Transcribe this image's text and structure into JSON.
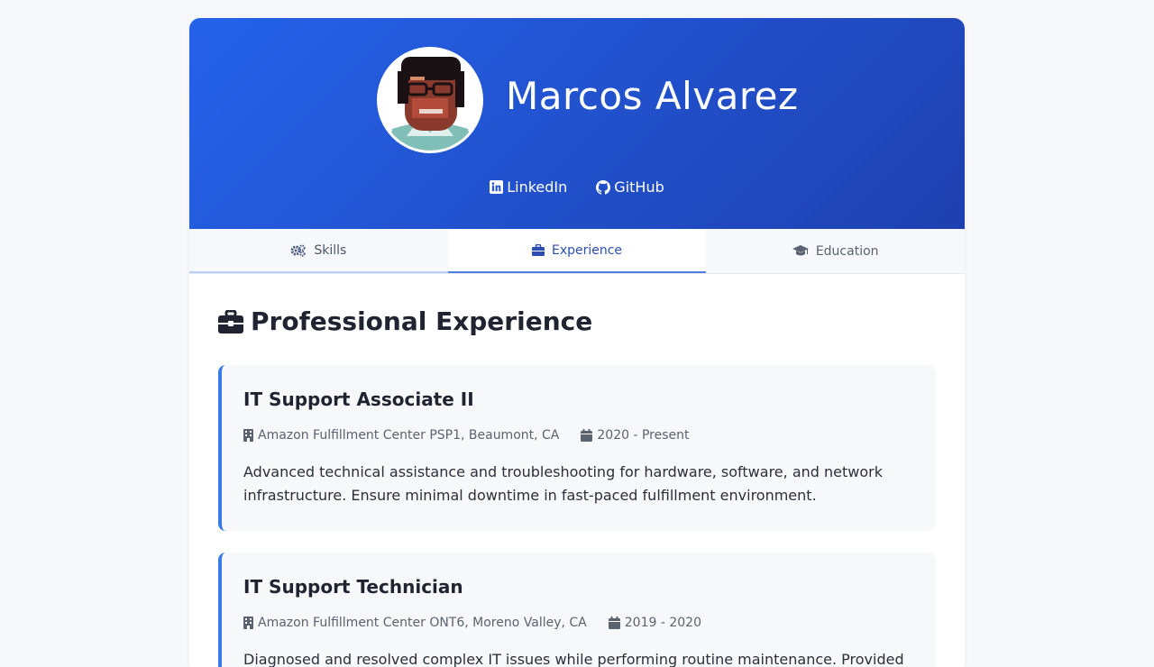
{
  "profile": {
    "name": "Marcos Alvarez",
    "links": [
      {
        "label": "LinkedIn",
        "icon": "linkedin-icon"
      },
      {
        "label": "GitHub",
        "icon": "github-icon"
      }
    ]
  },
  "tabs": [
    {
      "label": "Skills",
      "icon": "cogs-icon"
    },
    {
      "label": "Experience",
      "icon": "briefcase-icon",
      "active": true
    },
    {
      "label": "Education",
      "icon": "graduation-cap-icon"
    }
  ],
  "experience": {
    "title": "Professional Experience",
    "jobs": [
      {
        "title": "IT Support Associate II",
        "company": "Amazon Fulfillment Center PSP1, Beaumont, CA",
        "dates": "2020 - Present",
        "description": "Advanced technical assistance and troubleshooting for hardware, software, and network infrastructure. Ensure minimal downtime in fast-paced fulfillment environment."
      },
      {
        "title": "IT Support Technician",
        "company": "Amazon Fulfillment Center ONT6, Moreno Valley, CA",
        "dates": "2019 - 2020",
        "description": "Diagnosed and resolved complex IT issues while performing routine maintenance. Provided"
      }
    ]
  },
  "colors": {
    "hero_start": "#2563eb",
    "hero_end": "#1e40af",
    "accent": "#3b7be6"
  }
}
